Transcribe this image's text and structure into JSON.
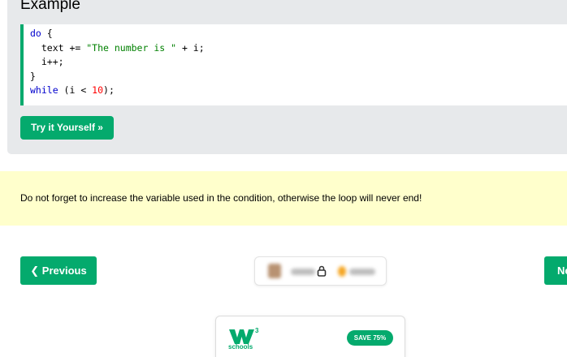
{
  "example": {
    "title": "Example",
    "code_lines": [
      {
        "parts": [
          {
            "t": "do",
            "c": "kw"
          },
          {
            "t": " {",
            "c": ""
          }
        ]
      },
      {
        "parts": [
          {
            "t": "  text += ",
            "c": ""
          },
          {
            "t": "\"The number is \"",
            "c": "str-green"
          },
          {
            "t": " + i;",
            "c": ""
          }
        ]
      },
      {
        "parts": [
          {
            "t": "  i++;",
            "c": ""
          }
        ]
      },
      {
        "parts": [
          {
            "t": "}",
            "c": ""
          }
        ]
      },
      {
        "parts": [
          {
            "t": "while",
            "c": "kw"
          },
          {
            "t": " (i < ",
            "c": ""
          },
          {
            "t": "10",
            "c": "num"
          },
          {
            "t": ");",
            "c": ""
          }
        ]
      }
    ],
    "try_label": "Try it Yourself »"
  },
  "note": {
    "text": "Do not forget to increase the variable used in the condition, otherwise the loop will never end!"
  },
  "nav": {
    "prev_label": "❮ Previous",
    "next_label": "Ne"
  },
  "promo_card": {
    "logo_text": "schools",
    "badge": "SAVE 75%"
  },
  "colors": {
    "accent": "#04aa6d",
    "note_bg": "#ffffcc",
    "example_bg": "#e7e9eb"
  }
}
